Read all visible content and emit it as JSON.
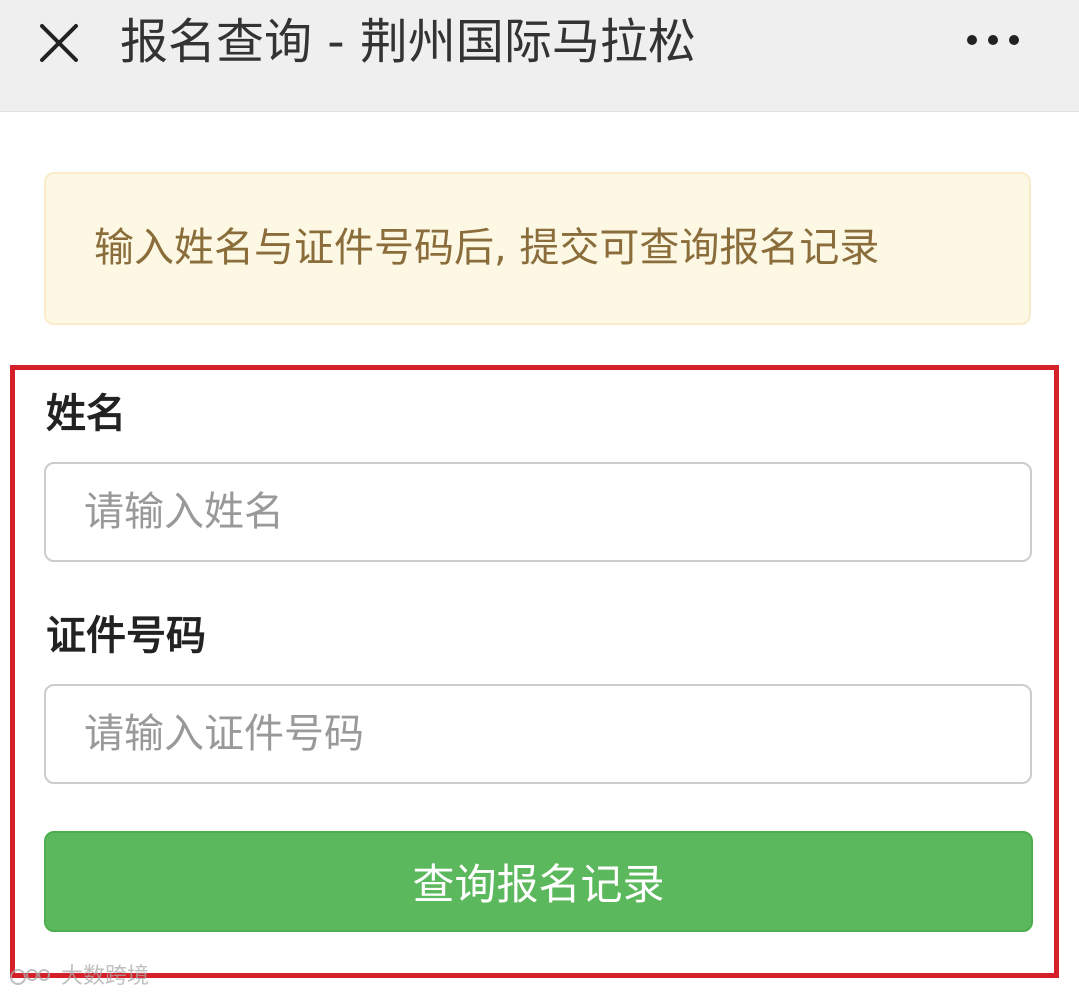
{
  "header": {
    "title": "报名查询 - 荆州国际马拉松",
    "close_icon": "close-icon",
    "more_icon": "more-horizontal-icon"
  },
  "notice": {
    "text": "输入姓名与证件号码后, 提交可查询报名记录"
  },
  "form": {
    "name": {
      "label": "姓名",
      "placeholder": "请输入姓名",
      "value": ""
    },
    "id_number": {
      "label": "证件号码",
      "placeholder": "请输入证件号码",
      "value": ""
    },
    "submit_label": "查询报名记录"
  },
  "watermark": {
    "text": "大数跨境"
  },
  "colors": {
    "topbar_bg": "#efefef",
    "notice_bg": "#fcf8e3",
    "notice_border": "#faebcc",
    "notice_text": "#8a6d3b",
    "highlight_border": "#d5202a",
    "button_bg": "#5cb85c",
    "button_text": "#ffffff"
  }
}
